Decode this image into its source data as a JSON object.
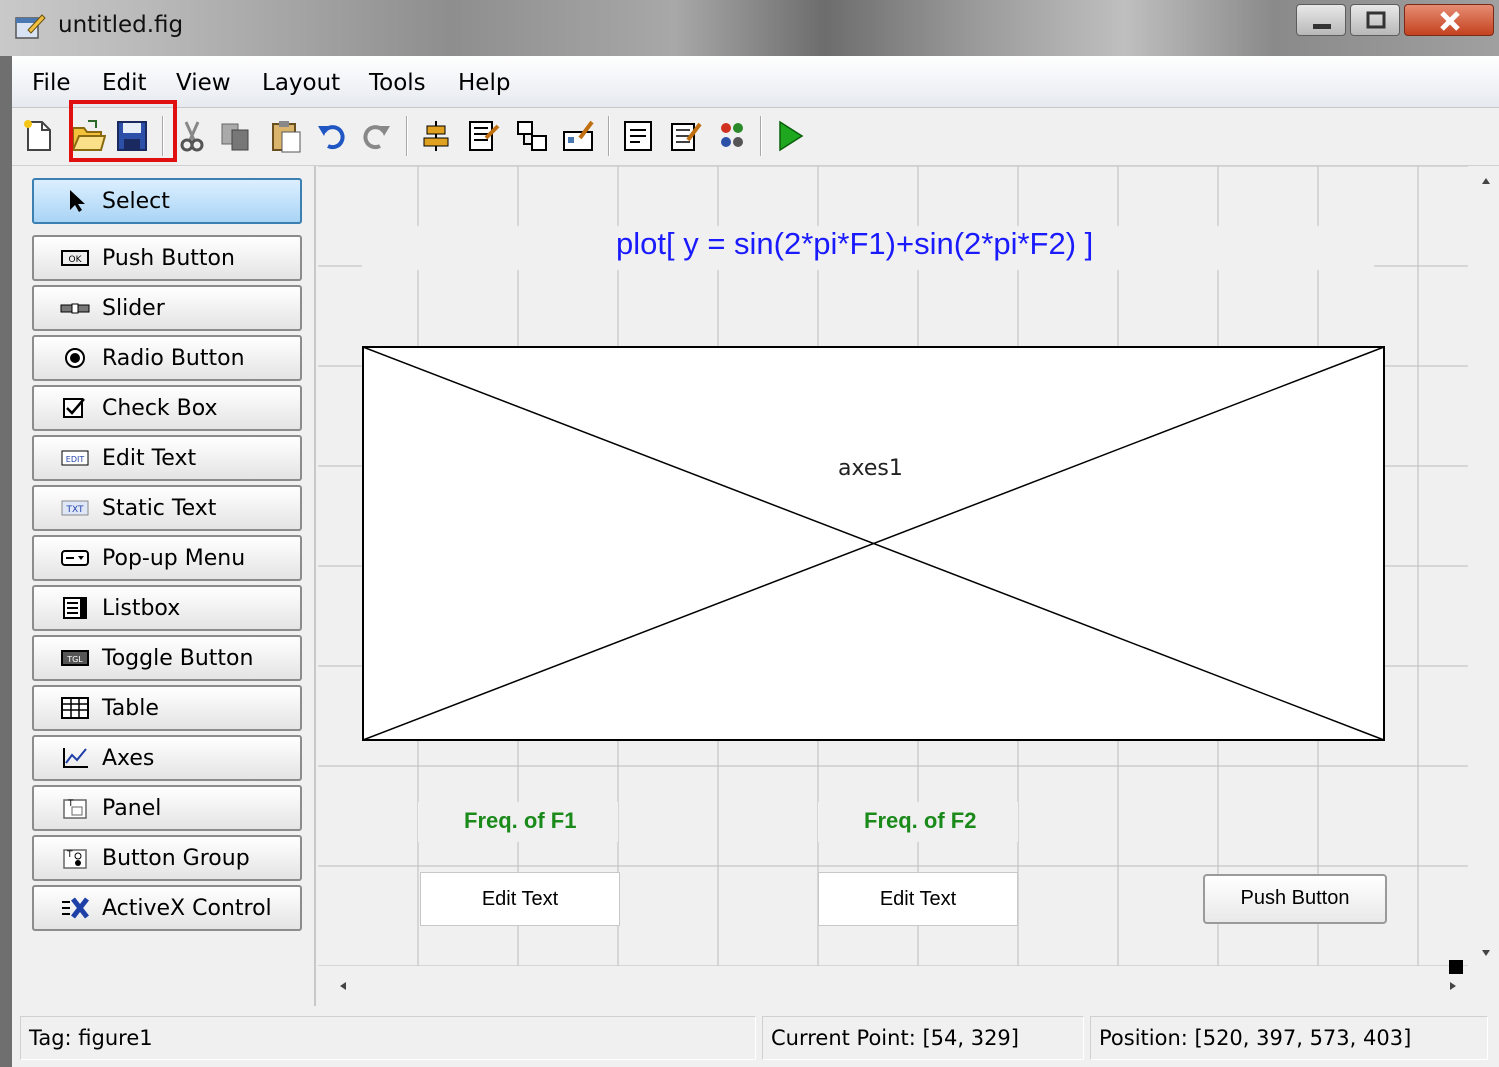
{
  "window": {
    "title": "untitled.fig"
  },
  "menubar": {
    "items": [
      "File",
      "Edit",
      "View",
      "Layout",
      "Tools",
      "Help"
    ]
  },
  "toolbar": {
    "buttons": [
      "new-figure-icon",
      "open-file-icon",
      "save-icon",
      "cut-icon",
      "copy-icon",
      "paste-icon",
      "undo-icon",
      "redo-icon",
      "align-objects-icon",
      "menu-editor-icon",
      "tab-order-editor-icon",
      "toolbar-editor-icon",
      "editor-icon",
      "property-inspector-icon",
      "object-browser-icon",
      "run-figure-icon"
    ],
    "highlight_color": "#e01010"
  },
  "palette": {
    "items": [
      {
        "label": "Select",
        "icon": "arrow-pointer-icon"
      },
      {
        "label": "Push Button",
        "icon": "push-button-icon"
      },
      {
        "label": "Slider",
        "icon": "slider-icon"
      },
      {
        "label": "Radio Button",
        "icon": "radio-button-icon"
      },
      {
        "label": "Check Box",
        "icon": "check-box-icon"
      },
      {
        "label": "Edit Text",
        "icon": "edit-text-icon"
      },
      {
        "label": "Static Text",
        "icon": "static-text-icon"
      },
      {
        "label": "Pop-up Menu",
        "icon": "popup-menu-icon"
      },
      {
        "label": "Listbox",
        "icon": "listbox-icon"
      },
      {
        "label": "Toggle Button",
        "icon": "toggle-button-icon"
      },
      {
        "label": "Table",
        "icon": "table-icon"
      },
      {
        "label": "Axes",
        "icon": "axes-icon"
      },
      {
        "label": "Panel",
        "icon": "panel-icon"
      },
      {
        "label": "Button Group",
        "icon": "button-group-icon"
      },
      {
        "label": "ActiveX Control",
        "icon": "activex-icon"
      }
    ]
  },
  "canvas": {
    "equation_label": "plot[ y = sin(2*pi*F1)+sin(2*pi*F2) ]",
    "axes_label": "axes1",
    "freq1_label": "Freq. of F1",
    "freq2_label": "Freq. of F2",
    "edit1_text": "Edit Text",
    "edit2_text": "Edit Text",
    "push_button_text": "Push Button",
    "equation_color": "#1a1aff",
    "freq_label_color": "#1a8a1a"
  },
  "statusbar": {
    "tag": "Tag: figure1",
    "current_point": "Current Point:  [54, 329]",
    "position": "Position: [520, 397, 573, 403]"
  }
}
